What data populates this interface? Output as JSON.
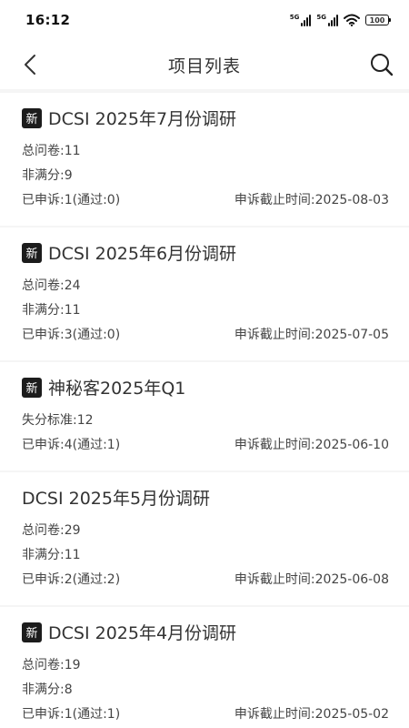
{
  "status_bar": {
    "time": "16:12",
    "signal_1": "5G",
    "signal_2": "5G",
    "battery": "100"
  },
  "header": {
    "title": "项目列表"
  },
  "projects": [
    {
      "is_new": true,
      "new_badge": "新",
      "title": "DCSI 2025年7月份调研",
      "stats": [
        "总问卷:11",
        "非满分:9"
      ],
      "appeal": "已申诉:1(通过:0)",
      "deadline": "申诉截止时间:2025-08-03"
    },
    {
      "is_new": true,
      "new_badge": "新",
      "title": "DCSI 2025年6月份调研",
      "stats": [
        "总问卷:24",
        "非满分:11"
      ],
      "appeal": "已申诉:3(通过:0)",
      "deadline": "申诉截止时间:2025-07-05"
    },
    {
      "is_new": true,
      "new_badge": "新",
      "title": "神秘客2025年Q1",
      "stats": [
        "失分标准:12"
      ],
      "appeal": "已申诉:4(通过:1)",
      "deadline": "申诉截止时间:2025-06-10"
    },
    {
      "is_new": false,
      "new_badge": "",
      "title": "DCSI 2025年5月份调研",
      "stats": [
        "总问卷:29",
        "非满分:11"
      ],
      "appeal": "已申诉:2(通过:2)",
      "deadline": "申诉截止时间:2025-06-08"
    },
    {
      "is_new": true,
      "new_badge": "新",
      "title": "DCSI 2025年4月份调研",
      "stats": [
        "总问卷:19",
        "非满分:8"
      ],
      "appeal": "已申诉:1(通过:1)",
      "deadline": "申诉截止时间:2025-05-02"
    }
  ]
}
